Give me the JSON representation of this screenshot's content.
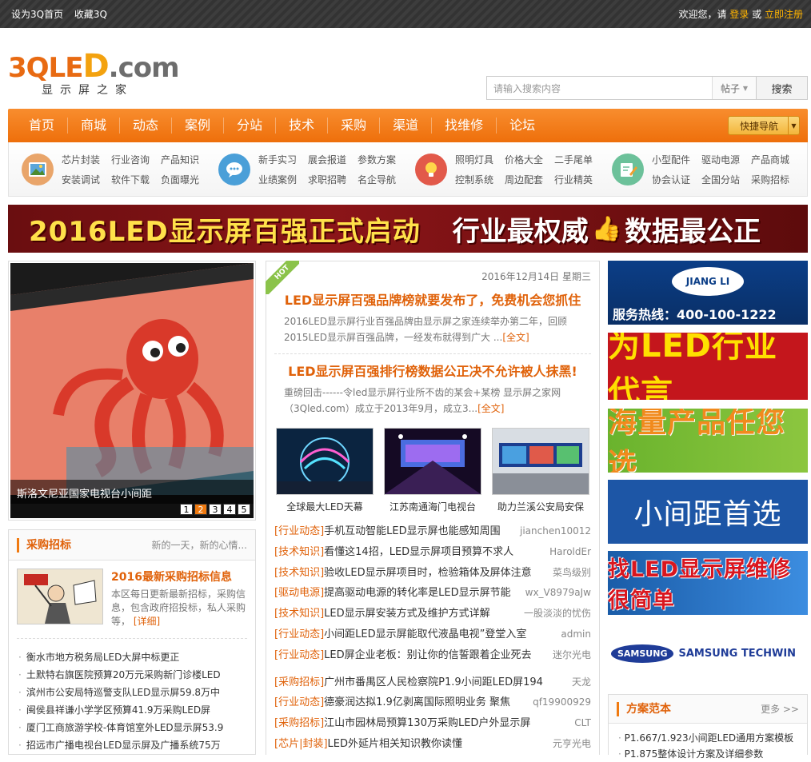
{
  "topbar": {
    "set_home": "设为3Q首页",
    "favorite": "收藏3Q",
    "welcome": "欢迎您，请",
    "login": "登录",
    "or": "或",
    "register": "立即注册"
  },
  "logo": {
    "mark_a": "3QLE",
    "mark_b": "D",
    "mark_c": ".com",
    "subtitle": "显示屏之家"
  },
  "search": {
    "placeholder": "请输入搜索内容",
    "scope": "帖子",
    "button": "搜索"
  },
  "nav": {
    "items": [
      "首页",
      "商城",
      "动态",
      "案例",
      "分站",
      "技术",
      "采购",
      "渠道",
      "找维修",
      "论坛"
    ],
    "quick": "快捷导航"
  },
  "cats": [
    {
      "icon": "image-icon",
      "links": [
        "芯片封装",
        "行业咨询",
        "产品知识",
        "安装调试",
        "软件下载",
        "负面曝光"
      ]
    },
    {
      "icon": "chat-icon",
      "links": [
        "新手实习",
        "展会报道",
        "参数方案",
        "业绩案例",
        "求职招聘",
        "名企导航"
      ]
    },
    {
      "icon": "lightbulb-icon",
      "links": [
        "照明灯具",
        "价格大全",
        "二手尾单",
        "控制系统",
        "周边配套",
        "行业精英"
      ]
    },
    {
      "icon": "edit-icon",
      "links": [
        "小型配件",
        "驱动电源",
        "产品商城",
        "协会认证",
        "全国分站",
        "采购招标"
      ]
    }
  ],
  "banner": {
    "left": "2016LED显示屏百强正式启动",
    "right_a": "行业最权威",
    "right_b": "数据最公正"
  },
  "slider": {
    "caption": "斯洛文尼亚国家电视台小间距",
    "pages": [
      "1",
      "2",
      "3",
      "4",
      "5"
    ],
    "active": 2
  },
  "procurement": {
    "title": "采购招标",
    "more": "新的一天，新的心情...",
    "feature_title": "2016最新采购招标信息",
    "feature_desc": "本区每日更新最新招标，采购信息，包含政府招投标，私人采购等，",
    "feature_more": "[详细]",
    "items": [
      "衡水市地方税务局LED大屏中标更正",
      "土默特右旗医院预算20万元采购新门诊楼LED",
      "滨州市公安局特巡警支队LED显示屏59.8万中",
      "闽侯县祥谦小学学区预算41.9万采购LED屏",
      "厦门工商旅游学校-体育馆室外LED显示屏53.9",
      "招远市广播电视台LED显示屏及广播系统75万"
    ]
  },
  "middle": {
    "hot": "HOT",
    "date": "2016年12月14日 星期三",
    "news": [
      {
        "title": "LED显示屏百强品牌榜就要发布了，免费机会您抓住",
        "desc": "2016LED显示屏行业百强品牌由显示屏之家连续举办第二年，回顾2015LED显示屏百强品牌，一经发布就得到广大 ...",
        "more": "[全文]"
      },
      {
        "title": "LED显示屏百强排行榜数据公正决不允许被人抹黑!",
        "desc": "重磅回击------令led显示屏行业所不齿的某会+某榜 显示屏之家网（3Qled.com）成立于2013年9月，成立3...",
        "more": "[全文]"
      }
    ],
    "thumbs": [
      "全球最大LED天幕",
      "江苏南通海门电视台",
      "助力兰溪公安局安保"
    ],
    "list": [
      {
        "tag": "[行业动态]",
        "title": "手机互动智能LED显示屏也能感知周围",
        "author": "jianchen10012"
      },
      {
        "tag": "[技术知识]",
        "title": "看懂这14招，LED显示屏项目预算不求人",
        "author": "HaroldEr"
      },
      {
        "tag": "[技术知识]",
        "title": "验收LED显示屏项目时，检验箱体及屏体注意",
        "author": "菜鸟级别"
      },
      {
        "tag": "[驱动电源]",
        "title": "提高驱动电源的转化率是LED显示屏节能",
        "author": "wx_V8979aJw"
      },
      {
        "tag": "[技术知识]",
        "title": "LED显示屏安装方式及维护方式详解",
        "author": "一股淡淡的忧伤"
      },
      {
        "tag": "[行业动态]",
        "title": "小间距LED显示屏能取代液晶电视”登堂入室",
        "author": "admin"
      },
      {
        "tag": "[行业动态]",
        "title": "LED屏企业老板：别让你的信誓跟着企业死去",
        "author": "迷尔光电"
      },
      {
        "tag": "[采购招标]",
        "title": "广州市番禺区人民检察院P1.9小间距LED屏194",
        "author": "天龙"
      },
      {
        "tag": "[行业动态]",
        "title": "德豪润达拟1.9亿剥离国际照明业务 聚焦",
        "author": "qf19900929"
      },
      {
        "tag": "[采购招标]",
        "title": "江山市园林局预算130万采购LED户外显示屏",
        "author": "CLT"
      },
      {
        "tag": "[芯片|封装]",
        "title": "LED外延片相关知识教你读懂",
        "author": "元亨光电"
      }
    ]
  },
  "ads": {
    "ad1_brand": "JIANG LI",
    "ad1_hotline": "服务热线：400-100-1222",
    "ad2": "为LED行业代言",
    "ad3": "海量产品任您选",
    "ad4": "小间距首选",
    "ad5": "找LED显示屏维修很简单",
    "ad6_logo": "SAMSUNG",
    "ad6_text": "SAMSUNG TECHWIN"
  },
  "fangan": {
    "title": "方案范本",
    "more": "更多 >>",
    "items": [
      "P1.667/1.923小间距LED通用方案模板",
      "P1.875整体设计方案及详细参数"
    ]
  },
  "colors": {
    "accent": "#ee6f0b",
    "link_orange": "#e0620a",
    "banner_red": "#8b1518"
  }
}
